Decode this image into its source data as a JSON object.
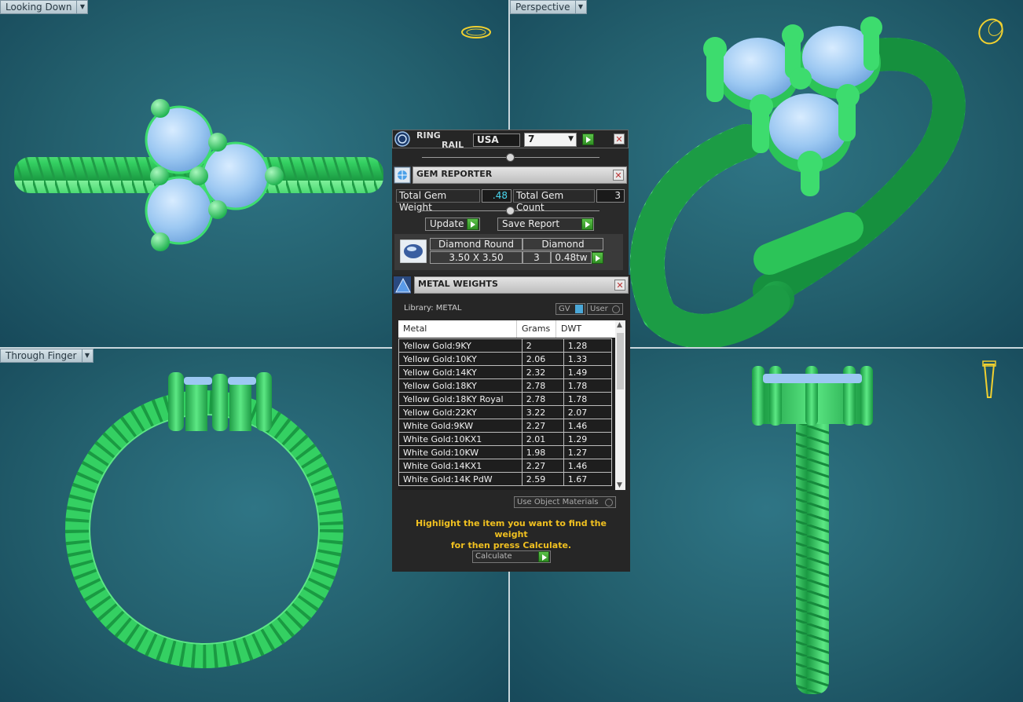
{
  "viewports": {
    "top_left": "Looking Down",
    "top_right": "Perspective",
    "bottom_left": "Through Finger"
  },
  "ring_rail": {
    "title_line1": "RING",
    "title_line2": "RAIL",
    "region": "USA",
    "size": "7"
  },
  "gem_reporter": {
    "title": "GEM REPORTER",
    "total_weight_label": "Total Gem Weight",
    "total_weight_value": ".48",
    "total_count_label": "Total Gem Count",
    "total_count_value": "3",
    "update_label": "Update",
    "save_report_label": "Save Report",
    "gem": {
      "shape": "Diamond Round",
      "material": "Diamond",
      "size": "3.50 X 3.50",
      "count": "3",
      "weight": "0.48tw"
    }
  },
  "metal_weights": {
    "title": "METAL WEIGHTS",
    "library_label": "Library:  METAL",
    "gv_label": "GV",
    "user_label": "User",
    "columns": [
      "Metal",
      "Grams",
      "DWT"
    ],
    "rows": [
      [
        "Yellow Gold:9KY",
        "2",
        "1.28"
      ],
      [
        "Yellow Gold:10KY",
        "2.06",
        "1.33"
      ],
      [
        "Yellow Gold:14KY",
        "2.32",
        "1.49"
      ],
      [
        "Yellow Gold:18KY",
        "2.78",
        "1.78"
      ],
      [
        "Yellow Gold:18KY Royal",
        "2.78",
        "1.78"
      ],
      [
        "Yellow Gold:22KY",
        "3.22",
        "2.07"
      ],
      [
        "White Gold:9KW",
        "2.27",
        "1.46"
      ],
      [
        "White Gold:10KX1",
        "2.01",
        "1.29"
      ],
      [
        "White Gold:10KW",
        "1.98",
        "1.27"
      ],
      [
        "White Gold:14KX1",
        "2.27",
        "1.46"
      ],
      [
        "White Gold:14K PdW",
        "2.59",
        "1.67"
      ]
    ],
    "use_object_materials_label": "Use Object Materials",
    "hint_line1": "Highlight the item you want to find the weight",
    "hint_line2": "for then press Calculate.",
    "calculate_label": "Calculate"
  },
  "colors": {
    "metal_green": "#3ddc6e",
    "gem_blue": "#9cc8f2",
    "viewport_bg": "#235f6d",
    "hint_yellow": "#f0c020"
  }
}
